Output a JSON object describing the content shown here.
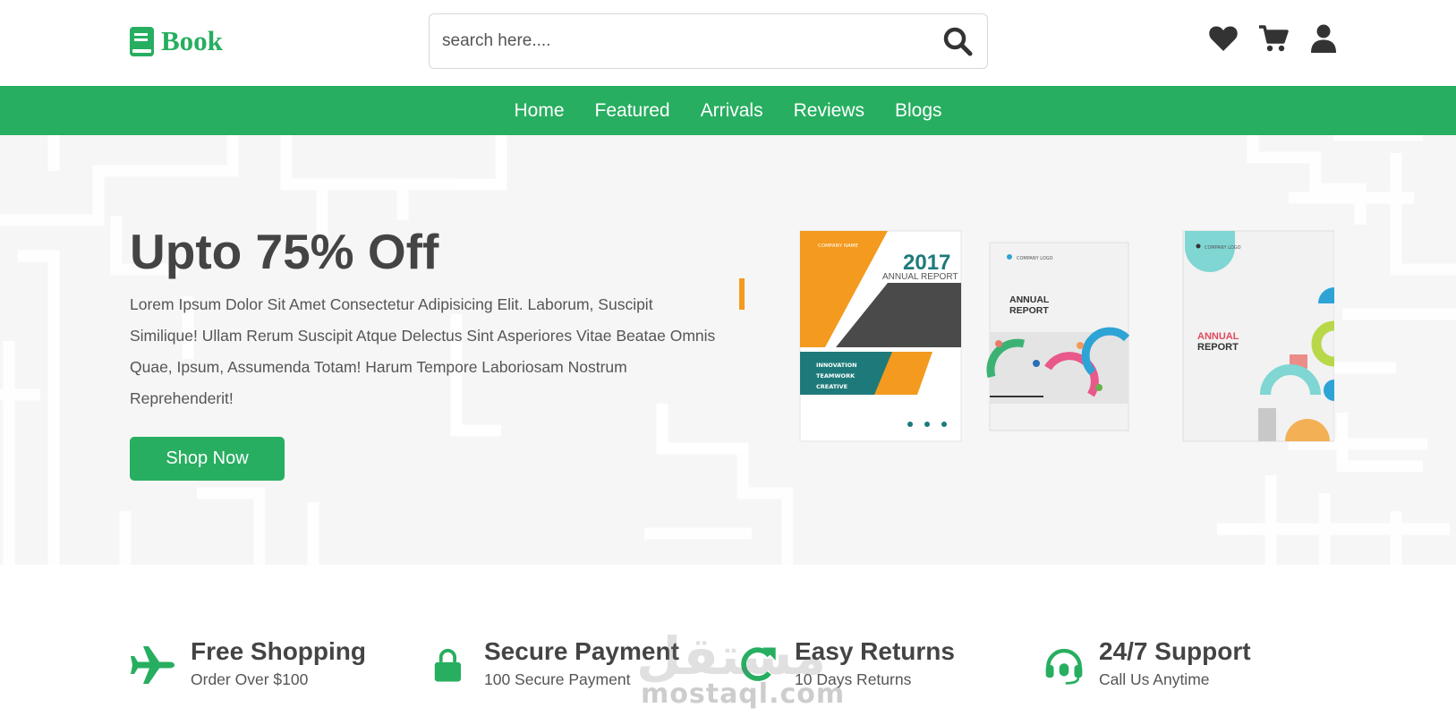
{
  "header": {
    "logo_text": "Book",
    "search_placeholder": "search here....",
    "icons": [
      "heart-icon",
      "cart-icon",
      "user-icon"
    ]
  },
  "nav": {
    "items": [
      "Home",
      "Featured",
      "Arrivals",
      "Reviews",
      "Blogs"
    ]
  },
  "hero": {
    "title": "Upto 75% Off",
    "description": "Lorem Ipsum Dolor Sit Amet Consectetur Adipisicing Elit. Laborum, Suscipit Similique! Ullam Rerum Suscipit Atque Delectus Sint Asperiores Vitae Beatae Omnis Quae, Ipsum, Assumenda Totam! Harum Tempore Laboriosam Nostrum Reprehenderit!",
    "button_label": "Shop Now",
    "books": [
      {
        "year": "2017",
        "title": "ANNUAL REPORT",
        "company": "COMPANY NAME",
        "tags": [
          "INNOVATION",
          "TEAMWORK",
          "CREATIVE"
        ]
      },
      {
        "company": "COMPANY LOGO",
        "title_line1": "ANNUAL",
        "title_line2": "REPORT"
      },
      {
        "company": "COMPANY LOGO",
        "title_line1": "ANNUAL",
        "title_line2": "REPORT"
      }
    ]
  },
  "features": [
    {
      "icon": "plane-icon",
      "title": "Free Shopping",
      "subtitle": "Order Over $100"
    },
    {
      "icon": "lock-icon",
      "title": "Secure Payment",
      "subtitle": "100 Secure Payment"
    },
    {
      "icon": "redo-icon",
      "title": "Easy Returns",
      "subtitle": "10 Days Returns"
    },
    {
      "icon": "headset-icon",
      "title": "24/7 Support",
      "subtitle": "Call Us Anytime"
    }
  ],
  "watermark": {
    "arabic": "مستقل",
    "latin": "mostaql.com"
  },
  "colors": {
    "accent": "#27ae60",
    "text": "#444444",
    "hero_bg": "#f6f6f6"
  }
}
